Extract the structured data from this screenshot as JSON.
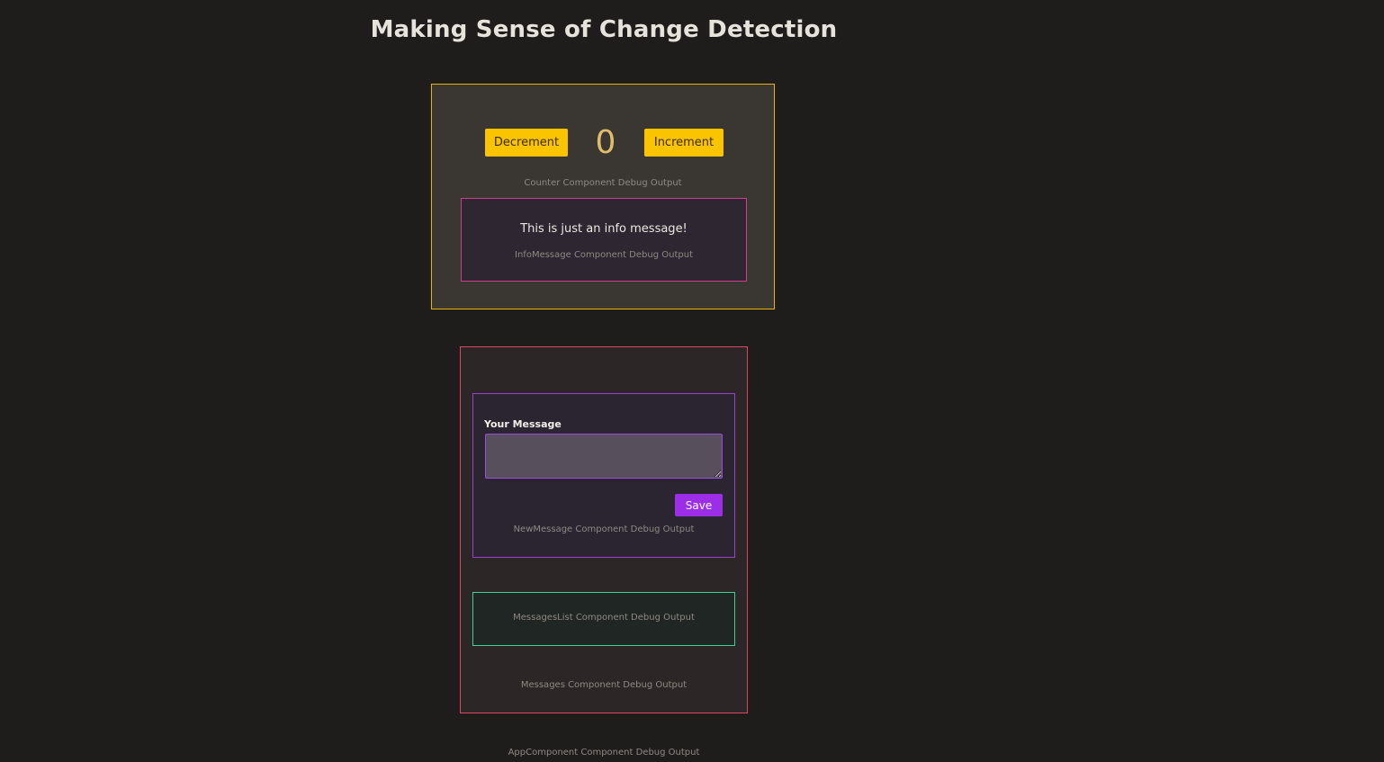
{
  "page": {
    "title": "Making Sense of Change Detection"
  },
  "counter": {
    "decrement_label": "Decrement",
    "increment_label": "Increment",
    "value": "0",
    "debug": "Counter Component Debug Output"
  },
  "info_message": {
    "text": "This is just an info message!",
    "debug": "InfoMessage Component Debug Output"
  },
  "new_message": {
    "label": "Your Message",
    "value": "",
    "save_label": "Save",
    "debug": "NewMessage Component Debug Output"
  },
  "messages_list": {
    "debug": "MessagesList Component Debug Output"
  },
  "messages": {
    "debug": "Messages Component Debug Output"
  },
  "app": {
    "debug": "AppComponent Component Debug Output"
  },
  "colors": {
    "background": "#1f1d1b",
    "counter_border": "#e8b400",
    "button_yellow": "#fac400",
    "info_border": "#d03c8e",
    "messages_border": "#e04565",
    "new_message_border": "#9b3fd6",
    "save_button": "#9b2ee6",
    "messages_list_border": "#3fcf94"
  }
}
